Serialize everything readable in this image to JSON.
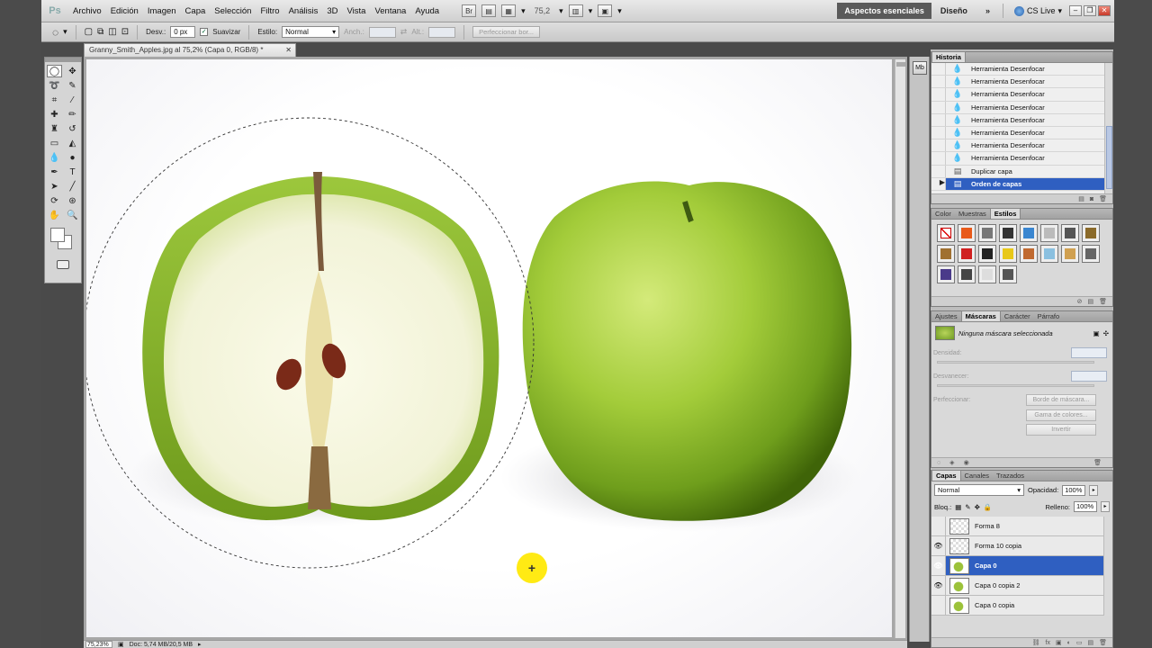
{
  "menubar": {
    "logo": "Ps",
    "items": [
      "Archivo",
      "Edición",
      "Imagen",
      "Capa",
      "Selección",
      "Filtro",
      "Análisis",
      "3D",
      "Vista",
      "Ventana",
      "Ayuda"
    ],
    "zoom": "75,2",
    "workspace_active": "Aspectos esenciales",
    "workspace_other": "Diseño",
    "more": "»",
    "cslive": "CS Live"
  },
  "options": {
    "desv_label": "Desv.:",
    "desv_value": "0 px",
    "suavizar_label": "Suavizar",
    "estilo_label": "Estilo:",
    "estilo_value": "Normal",
    "anch_label": "Anch.:",
    "alt_label": "Alt.:",
    "refine_button": "Perfeccionar bor..."
  },
  "document": {
    "tab_title": "Granny_Smith_Apples.jpg al 75,2% (Capa 0, RGB/8) *",
    "status_zoom": "75,23%",
    "status_doc": "Doc: 5,74 MB/20,5 MB"
  },
  "history": {
    "tabs": [
      "Historia"
    ],
    "items": [
      {
        "label": "Herramienta Desenfocar",
        "icon": "drop-icon"
      },
      {
        "label": "Herramienta Desenfocar",
        "icon": "drop-icon"
      },
      {
        "label": "Herramienta Desenfocar",
        "icon": "drop-icon"
      },
      {
        "label": "Herramienta Desenfocar",
        "icon": "drop-icon"
      },
      {
        "label": "Herramienta Desenfocar",
        "icon": "drop-icon"
      },
      {
        "label": "Herramienta Desenfocar",
        "icon": "drop-icon"
      },
      {
        "label": "Herramienta Desenfocar",
        "icon": "drop-icon"
      },
      {
        "label": "Herramienta Desenfocar",
        "icon": "drop-icon"
      },
      {
        "label": "Duplicar capa",
        "icon": "layer-icon"
      },
      {
        "label": "Orden de capas",
        "icon": "layer-icon",
        "selected": true
      }
    ]
  },
  "styles_panel": {
    "tabs": [
      "Color",
      "Muestras",
      "Estilos"
    ],
    "active_tab": "Estilos",
    "swatches": [
      "#ffffff",
      "#e85a1a",
      "#777777",
      "#333333",
      "#3a86d0",
      "#bbbbbb",
      "#555555",
      "#8a6a2a",
      "#a07030",
      "#d02020",
      "#222222",
      "#e8c818",
      "#c06a30",
      "#8ac0e0",
      "#d0a050",
      "#666666",
      "#4a3a8a",
      "#444444",
      "#dddddd",
      "#555555"
    ]
  },
  "masks_panel": {
    "tabs": [
      "Ajustes",
      "Máscaras",
      "Carácter",
      "Párrafo"
    ],
    "active_tab": "Máscaras",
    "header": "Ninguna máscara seleccionada",
    "density_label": "Densidad:",
    "feather_label": "Desvanecer:",
    "refine_label": "Perfeccionar:",
    "buttons": [
      "Borde de máscara...",
      "Gama de colores...",
      "Invertir"
    ]
  },
  "layers_panel": {
    "tabs": [
      "Capas",
      "Canales",
      "Trazados"
    ],
    "active_tab": "Capas",
    "blend_mode": "Normal",
    "opacity_label": "Opacidad:",
    "opacity_value": "100%",
    "lock_label": "Bloq.:",
    "fill_label": "Relleno:",
    "fill_value": "100%",
    "layers": [
      {
        "name": "Forma 8",
        "visible": false,
        "thumb": "transparent"
      },
      {
        "name": "Forma 10 copia",
        "visible": true,
        "thumb": "transparent"
      },
      {
        "name": "Capa 0",
        "visible": true,
        "thumb": "apple",
        "selected": true
      },
      {
        "name": "Capa 0 copia 2",
        "visible": true,
        "thumb": "apple"
      },
      {
        "name": "Capa 0 copia",
        "visible": false,
        "thumb": "apple"
      }
    ]
  }
}
